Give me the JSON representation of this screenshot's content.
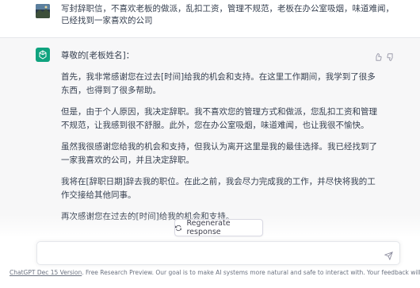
{
  "user_message": {
    "text": "写封辞职信，不喜欢老板的做派，乱扣工资，管理不规范，老板在办公室吸烟，味道难闻，已经找到一家喜欢的公司"
  },
  "assistant_message": {
    "paragraphs": [
      "尊敬的[老板姓名]：",
      "首先，我非常感谢您在过去[时间]给我的机会和支持。在这里工作期间，我学到了很多东西，也得到了很多帮助。",
      "但是，由于个人原因，我决定辞职。我不喜欢您的管理方式和做派，您乱扣工资和管理不规范，让我感到很不舒服。此外，您在办公室吸烟，味道难闻，也让我很不愉快。",
      "虽然我很感谢您给我的机会和支持，但我认为离开这里是我的最佳选择。我已经找到了一家我喜欢的公司，并且决定辞职。",
      "我将在[辞职日期]辞去我的职位。在此之前，我会尽力完成我的工作，并尽快将我的工作交接给其他同事。",
      "再次感谢您在过去的[时间]给我的机会和支持。"
    ]
  },
  "regenerate": {
    "label": "Regenerate response"
  },
  "input": {
    "placeholder": ""
  },
  "footer": {
    "link": "ChatGPT Dec 15 Version",
    "text": ". Free Research Preview. Our goal is to make AI systems more natural and safe to interact with. Your feedback will help us improve."
  },
  "colors": {
    "brand": "#10a37f",
    "assistant_bg": "#f7f7f8"
  },
  "icons": [
    "user-avatar",
    "openai-logo",
    "thumbs-up-icon",
    "thumbs-down-icon",
    "refresh-icon",
    "send-icon"
  ]
}
